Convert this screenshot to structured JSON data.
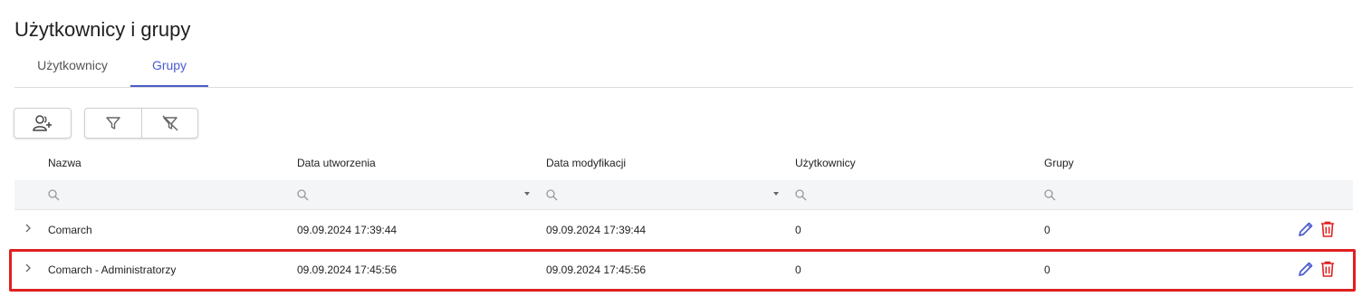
{
  "page": {
    "title": "Użytkownicy i grupy"
  },
  "tabs": [
    {
      "label": "Użytkownicy",
      "active": false
    },
    {
      "label": "Grupy",
      "active": true
    }
  ],
  "toolbar": {
    "add_icon": "add-user-icon",
    "filter_icon": "filter-icon",
    "clear_filter_icon": "filter-clear-icon"
  },
  "table": {
    "columns": [
      "Nazwa",
      "Data utworzenia",
      "Data modyfikacji",
      "Użytkownicy",
      "Grupy"
    ],
    "rows": [
      {
        "name": "Comarch",
        "created": "09.09.2024 17:39:44",
        "modified": "09.09.2024 17:39:44",
        "users": "0",
        "groups": "0"
      },
      {
        "name": "Comarch - Administratorzy",
        "created": "09.09.2024 17:45:56",
        "modified": "09.09.2024 17:45:56",
        "users": "0",
        "groups": "0"
      }
    ]
  },
  "colors": {
    "accent": "#4a5cd0",
    "delete": "#e02020",
    "highlight": "#e02020"
  }
}
